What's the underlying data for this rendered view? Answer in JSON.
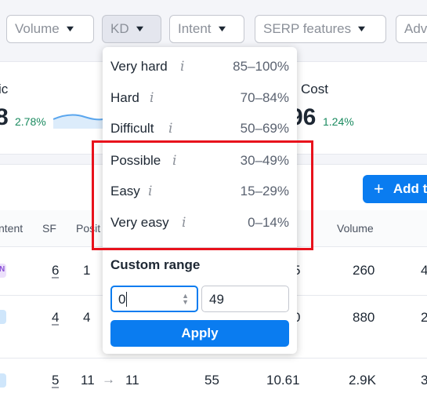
{
  "filters": {
    "volume": "Volume",
    "kd": "KD",
    "intent": "Intent",
    "serp_features": "SERP features",
    "advanced": "Adv"
  },
  "metrics": {
    "traffic": {
      "label": "ic",
      "value": "8",
      "change": "2.78%"
    },
    "cost": {
      "label": "Cost",
      "value": "96",
      "change": "1.24%"
    }
  },
  "add_button": {
    "label": "Add t"
  },
  "table": {
    "headers": {
      "intent": "ntent",
      "sf": "SF",
      "position": "Posit",
      "volume": "Volume"
    },
    "rows": [
      {
        "intent_badge": "N",
        "sf": "6",
        "position": "1",
        "kd_partial": "5",
        "volume": "260",
        "trailing": "4"
      },
      {
        "intent_badge": "",
        "sf": "4",
        "position": "4",
        "kd_partial": "0",
        "volume": "880",
        "trailing": "2"
      },
      {
        "intent_badge": "",
        "sf": "5",
        "position": "11",
        "position_arrow": "→",
        "position_new": "11",
        "kd": "55",
        "cpc": "10.61",
        "volume": "2.9K",
        "trailing": "3"
      }
    ]
  },
  "kd_dropdown": {
    "options": [
      {
        "label": "Very hard",
        "range": "85–100%"
      },
      {
        "label": "Hard",
        "range": "70–84%"
      },
      {
        "label": "Difficult",
        "range": "50–69%"
      },
      {
        "label": "Possible",
        "range": "30–49%"
      },
      {
        "label": "Easy",
        "range": "15–29%"
      },
      {
        "label": "Very easy",
        "range": "0–14%"
      }
    ],
    "info_glyph": "i",
    "custom_range_title": "Custom range",
    "from_value": "0",
    "to_value": "49",
    "apply_label": "Apply"
  },
  "colors": {
    "accent": "#0a7cf0",
    "highlight": "#e8121c",
    "positive": "#1a8a5f"
  }
}
